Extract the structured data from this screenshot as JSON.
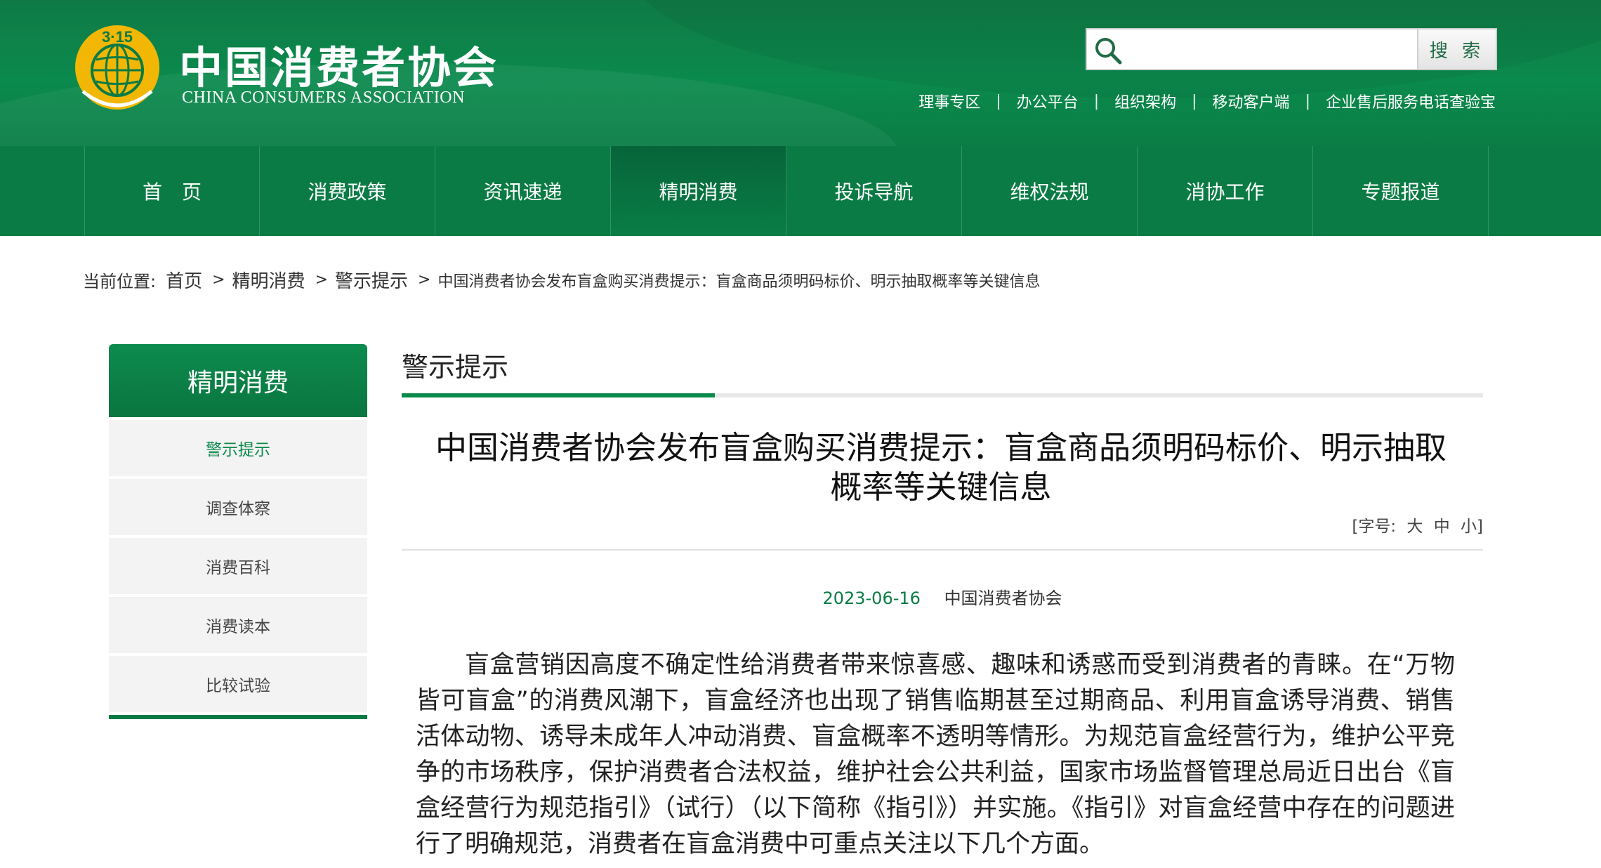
{
  "header": {
    "logo_badge": "3·15",
    "org_name_cn": "中国消费者协会",
    "org_name_en": "CHINA CONSUMERS ASSOCIATION",
    "search": {
      "placeholder": "",
      "button_label": "搜 索",
      "icon": "search-icon"
    },
    "top_links": [
      "理事专区",
      "办公平台",
      "组织架构",
      "移动客户端",
      "企业售后服务电话查验宝"
    ],
    "top_link_separator": "|"
  },
  "nav": {
    "items": [
      "首　页",
      "消费政策",
      "资讯速递",
      "精明消费",
      "投诉导航",
      "维权法规",
      "消协工作",
      "专题报道"
    ],
    "active_index": 3
  },
  "breadcrumb": {
    "prefix": "当前位置:",
    "items": [
      "首页",
      "精明消费",
      "警示提示"
    ],
    "current": "中国消费者协会发布盲盒购买消费提示：盲盒商品须明码标价、明示抽取概率等关键信息",
    "separator": ">"
  },
  "sidebar": {
    "title": "精明消费",
    "items": [
      "警示提示",
      "调查体察",
      "消费百科",
      "消费读本",
      "比较试验"
    ],
    "active_index": 0
  },
  "main": {
    "section_title": "警示提示",
    "article": {
      "title": "中国消费者协会发布盲盒购买消费提示：盲盒商品须明码标价、明示抽取概率等关键信息",
      "font_size_label": "[字号:",
      "font_size_options": [
        "大",
        "中",
        "小"
      ],
      "font_size_close": "]",
      "date": "2023-06-16",
      "source": "中国消费者协会",
      "body": "盲盒营销因高度不确定性给消费者带来惊喜感、趣味和诱惑而受到消费者的青睐。在“万物皆可盲盒”的消费风潮下，盲盒经济也出现了销售临期甚至过期商品、利用盲盒诱导消费、销售活体动物、诱导未成年人冲动消费、盲盒概率不透明等情形。为规范盲盒经营行为，维护公平竞争的市场秩序，保护消费者合法权益，维护社会公共利益，国家市场监督管理总局近日出台《盲盒经营行为规范指引》（试行）（以下简称《指引》）并实施。《指引》对盲盒经营中存在的问题进行了明确规范，消费者在盲盒消费中可重点关注以下几个方面。"
    }
  },
  "colors": {
    "brand_green": "#0a7b44",
    "accent_green": "#0a8a4a",
    "logo_gold": "#f2b705"
  }
}
